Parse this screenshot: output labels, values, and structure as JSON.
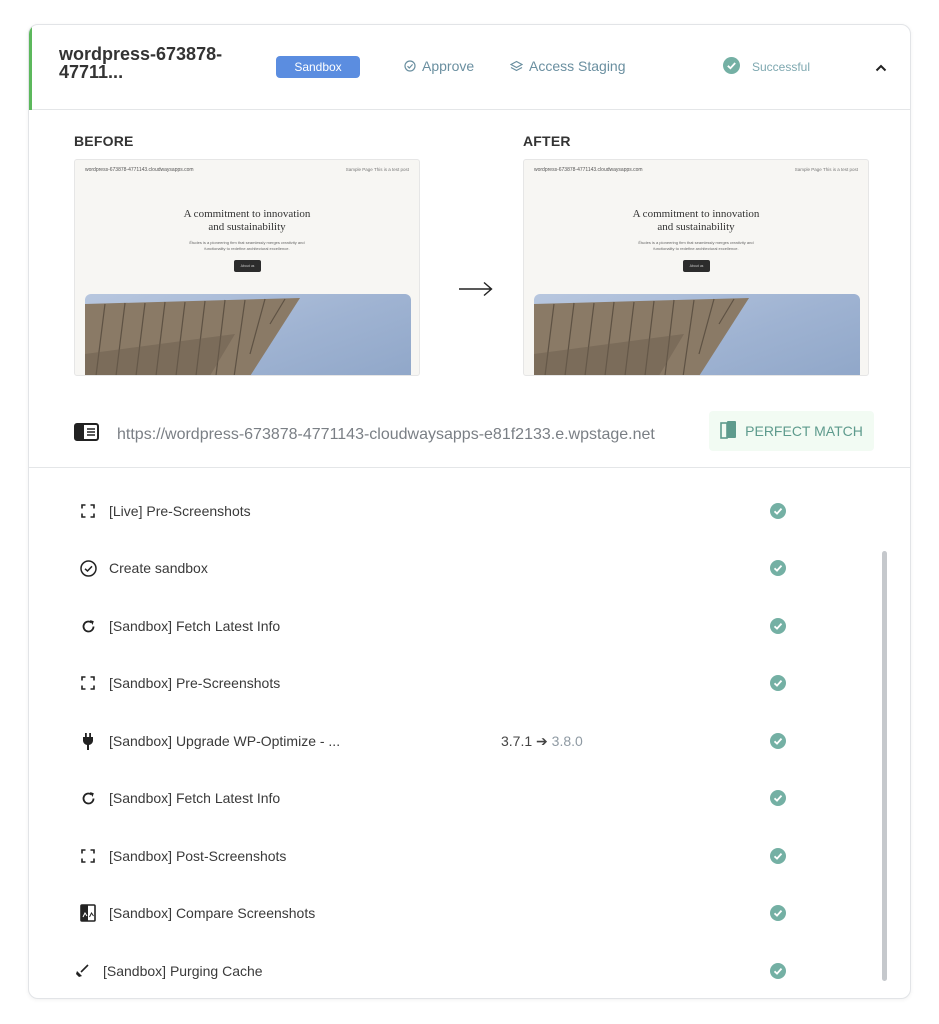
{
  "header": {
    "site_name": "wordpress-673878-47711...",
    "badge": "Sandbox",
    "approve_label": "Approve",
    "access_staging_label": "Access Staging",
    "status_label": "Successful",
    "accent_color": "#5cb85c",
    "badge_color": "#5b8de0"
  },
  "compare": {
    "before_label": "BEFORE",
    "after_label": "AFTER",
    "preview": {
      "site_url": "wordpress-673878-4771143.cloudwaysapps.com",
      "nav": "Sample Page   This is a test post",
      "headline_1": "A commitment to innovation",
      "headline_2": "and sustainability",
      "sub_1": "Études is a pioneering firm that seamlessly merges creativity and",
      "sub_2": "functionality to redefine architectural excellence.",
      "cta": "About us"
    },
    "url": "https://wordpress-673878-4771143-cloudwaysapps-e81f2133.e.wpstage.net",
    "match_label": "PERFECT MATCH"
  },
  "steps": [
    {
      "icon": "screenshot-icon",
      "label": "[Live] Pre-Screenshots",
      "from": "",
      "to": ""
    },
    {
      "icon": "check-circle-icon",
      "label": "Create sandbox",
      "from": "",
      "to": ""
    },
    {
      "icon": "refresh-icon",
      "label": "[Sandbox] Fetch Latest Info",
      "from": "",
      "to": ""
    },
    {
      "icon": "screenshot-icon",
      "label": "[Sandbox] Pre-Screenshots",
      "from": "",
      "to": ""
    },
    {
      "icon": "plug-icon",
      "label": "[Sandbox] Upgrade WP-Optimize - ...",
      "from": "3.7.1",
      "to": "3.8.0"
    },
    {
      "icon": "refresh-icon",
      "label": "[Sandbox] Fetch Latest Info",
      "from": "",
      "to": ""
    },
    {
      "icon": "screenshot-icon",
      "label": "[Sandbox] Post-Screenshots",
      "from": "",
      "to": ""
    },
    {
      "icon": "compare-icon",
      "label": "[Sandbox] Compare Screenshots",
      "from": "",
      "to": ""
    },
    {
      "icon": "broom-icon",
      "label": "[Sandbox] Purging Cache",
      "from": "",
      "to": ""
    }
  ]
}
